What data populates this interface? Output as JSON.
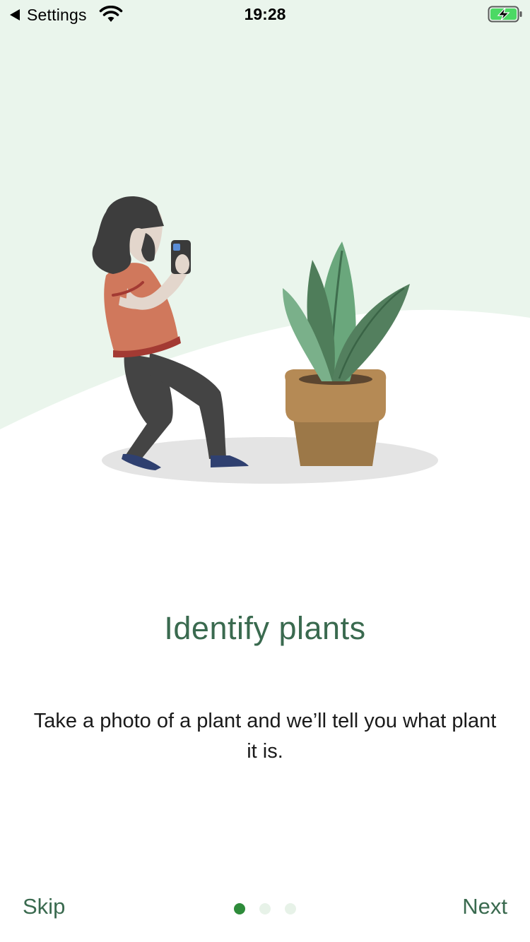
{
  "status_bar": {
    "back_label": "Settings",
    "time": "19:28",
    "wifi_icon": "wifi-icon",
    "battery_icon": "battery-charging-icon"
  },
  "onboarding": {
    "title": "Identify plants",
    "description": "Take a photo of a plant and we’ll tell you what plant it is.",
    "skip_label": "Skip",
    "next_label": "Next",
    "page_count": 3,
    "active_page": 1
  },
  "colors": {
    "accent": "#3a6a4f",
    "active_dot": "#2e8b3a",
    "inactive_dot": "#e7f2e8",
    "background_tint": "#eaf5ec"
  }
}
